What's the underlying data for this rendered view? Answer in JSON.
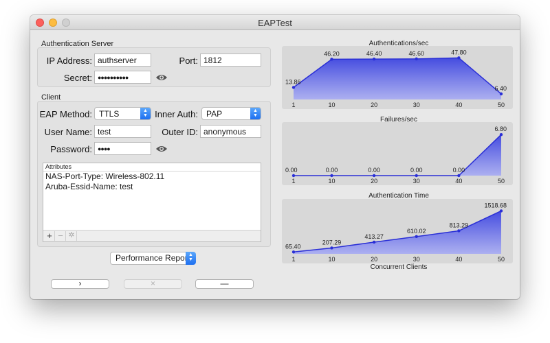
{
  "window": {
    "title": "EAPTest"
  },
  "server": {
    "section_label": "Authentication Server",
    "ip_label": "IP Address:",
    "ip_value": "authserver",
    "port_label": "Port:",
    "port_value": "1812",
    "secret_label": "Secret:",
    "secret_value": "●●●●●●●●●●"
  },
  "client": {
    "section_label": "Client",
    "eap_method_label": "EAP Method:",
    "eap_method_value": "TTLS",
    "inner_auth_label": "Inner Auth:",
    "inner_auth_value": "PAP",
    "username_label": "User Name:",
    "username_value": "test",
    "outer_id_label": "Outer ID:",
    "outer_id_value": "anonymous",
    "password_label": "Password:",
    "password_value": "●●●●",
    "attributes_header": "Attributes",
    "attributes": [
      "NAS-Port-Type: Wireless-802.11",
      "Aruba-Essid-Name: test"
    ],
    "add_symbol": "+",
    "remove_symbol": "−",
    "gear_symbol": "✲"
  },
  "report": {
    "value": "Performance Report"
  },
  "buttons": {
    "start": "›",
    "stop": "×",
    "minus": "—"
  },
  "icons": {
    "eye": "eye-icon",
    "stepper": "chevron-updown-icon"
  },
  "colors": {
    "area": "#6b72e8",
    "line": "#2a2fd6",
    "panel": "#d8d8d8"
  },
  "footer": {
    "x_caption": "Concurrent Clients"
  },
  "chart_data": [
    {
      "type": "area",
      "title": "Authentications/sec",
      "x": [
        1,
        10,
        20,
        30,
        40,
        50
      ],
      "values": [
        13.86,
        46.2,
        46.4,
        46.6,
        47.8,
        6.4
      ],
      "labels": [
        "13.86",
        "46.20",
        "46.40",
        "46.60",
        "47.80",
        "6.40"
      ],
      "ylim": [
        0,
        52
      ]
    },
    {
      "type": "area",
      "title": "Failures/sec",
      "x": [
        1,
        10,
        20,
        30,
        40,
        50
      ],
      "values": [
        0,
        0,
        0,
        0,
        0,
        6.8
      ],
      "labels": [
        "0.00",
        "0.00",
        "0.00",
        "0.00",
        "0.00",
        "6.80"
      ],
      "ylim": [
        0,
        7.5
      ]
    },
    {
      "type": "area",
      "title": "Authentication Time",
      "x": [
        1,
        10,
        20,
        30,
        40,
        50
      ],
      "values": [
        65.4,
        207.29,
        413.27,
        610.02,
        813.29,
        1518.68
      ],
      "labels": [
        "65.40",
        "207.29",
        "413.27",
        "610.02",
        "813.29",
        "1518.68"
      ],
      "ylim": [
        0,
        1650
      ]
    }
  ]
}
